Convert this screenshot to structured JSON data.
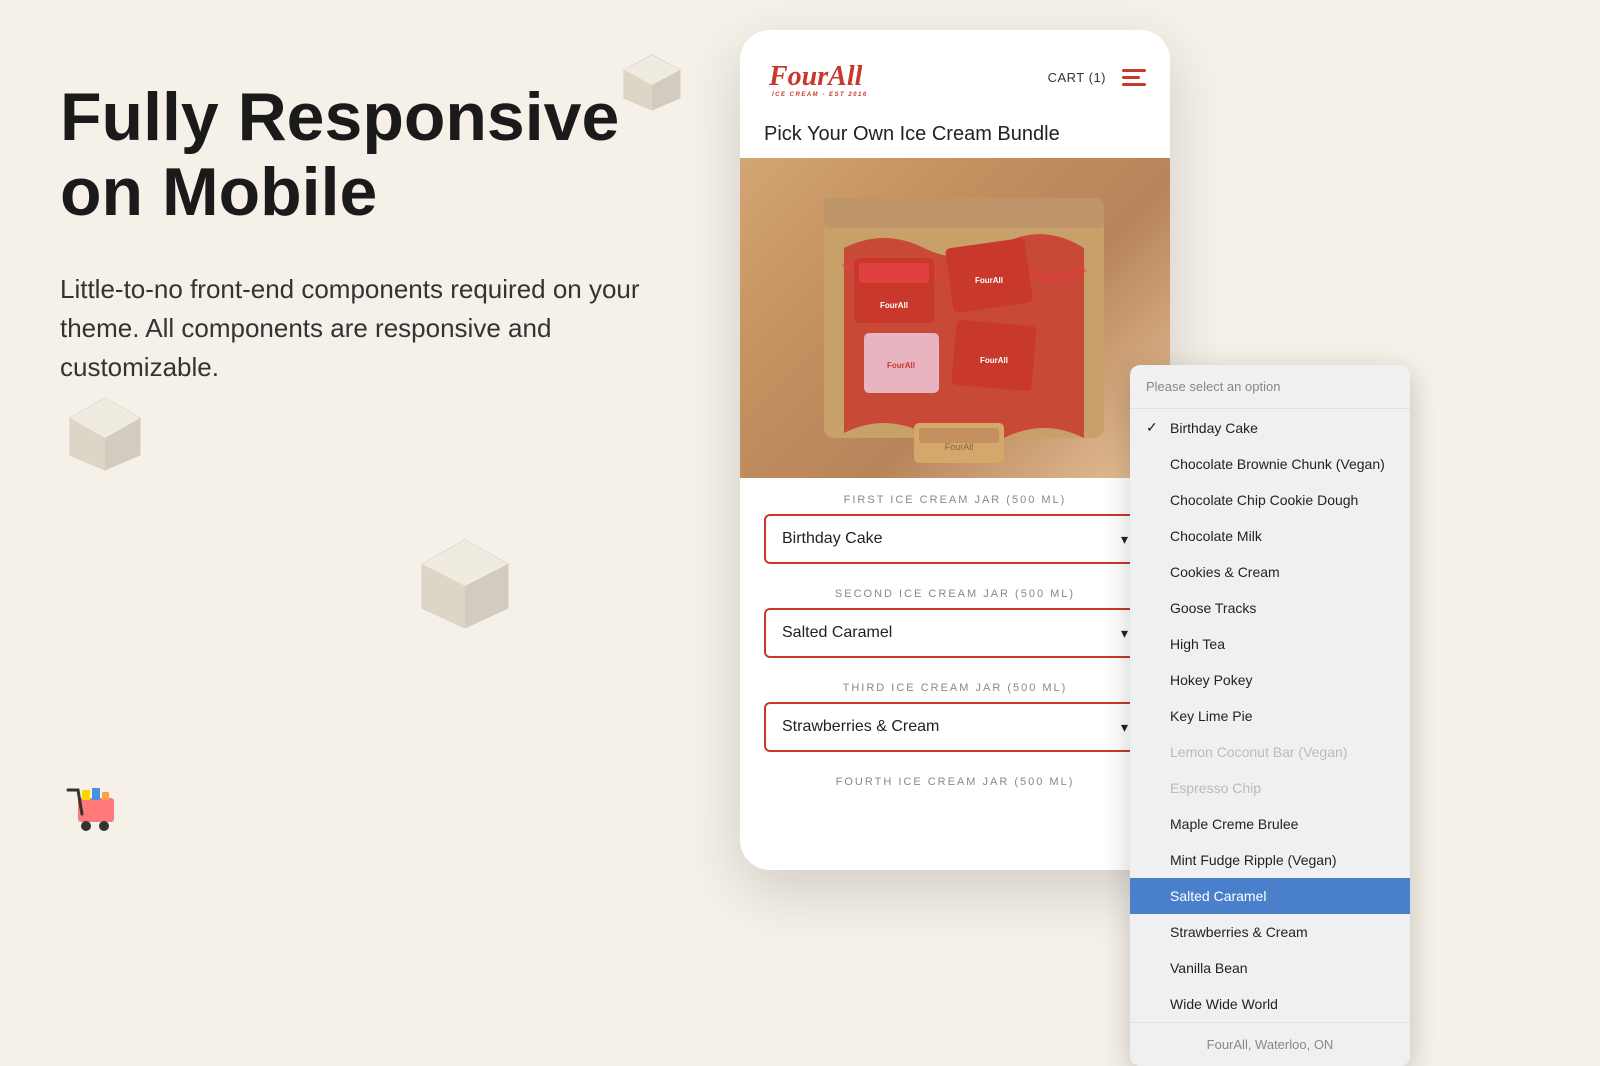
{
  "page": {
    "background_color": "#f5f0e8"
  },
  "left": {
    "heading_line1": "Fully Responsive",
    "heading_line2": "on Mobile",
    "description": "Little-to-no front-end components required on your theme. All components are responsive and customizable."
  },
  "phone": {
    "logo_text": "FourAll",
    "logo_sub": "ICE CREAM · EST 2016",
    "cart_label": "CART (1)",
    "page_title": "Pick Your Own Ice Cream Bundle",
    "jars": [
      {
        "label": "FIRST ICE CREAM JAR (500 ML)",
        "selected": "Birthday Cake"
      },
      {
        "label": "SECOND ICE CREAM JAR (500 ML)",
        "selected": "Salted Caramel"
      },
      {
        "label": "THIRD ICE CREAM JAR (500 ML)",
        "selected": "Strawberries & Cream"
      },
      {
        "label": "FOURTH ICE CREAM JAR (500 ML)",
        "selected": ""
      }
    ]
  },
  "dropdown": {
    "header": "Please select an option",
    "footer": "FourAll, Waterloo, ON",
    "items": [
      {
        "label": "Birthday Cake",
        "checked": true,
        "disabled": false,
        "selected": false
      },
      {
        "label": "Chocolate Brownie Chunk (Vegan)",
        "checked": false,
        "disabled": false,
        "selected": false
      },
      {
        "label": "Chocolate Chip Cookie Dough",
        "checked": false,
        "disabled": false,
        "selected": false
      },
      {
        "label": "Chocolate Milk",
        "checked": false,
        "disabled": false,
        "selected": false
      },
      {
        "label": "Cookies & Cream",
        "checked": false,
        "disabled": false,
        "selected": false
      },
      {
        "label": "Goose Tracks",
        "checked": false,
        "disabled": false,
        "selected": false
      },
      {
        "label": "High Tea",
        "checked": false,
        "disabled": false,
        "selected": false
      },
      {
        "label": "Hokey Pokey",
        "checked": false,
        "disabled": false,
        "selected": false
      },
      {
        "label": "Key Lime Pie",
        "checked": false,
        "disabled": false,
        "selected": false
      },
      {
        "label": "Lemon Coconut Bar (Vegan)",
        "checked": false,
        "disabled": true,
        "selected": false
      },
      {
        "label": "Espresso Chip",
        "checked": false,
        "disabled": true,
        "selected": false
      },
      {
        "label": "Maple Creme Brulee",
        "checked": false,
        "disabled": false,
        "selected": false
      },
      {
        "label": "Mint Fudge Ripple (Vegan)",
        "checked": false,
        "disabled": false,
        "selected": false
      },
      {
        "label": "Salted Caramel",
        "checked": false,
        "disabled": false,
        "selected": true
      },
      {
        "label": "Strawberries & Cream",
        "checked": false,
        "disabled": false,
        "selected": false
      },
      {
        "label": "Vanilla Bean",
        "checked": false,
        "disabled": false,
        "selected": false
      },
      {
        "label": "Wide Wide World",
        "checked": false,
        "disabled": false,
        "selected": false
      }
    ]
  }
}
